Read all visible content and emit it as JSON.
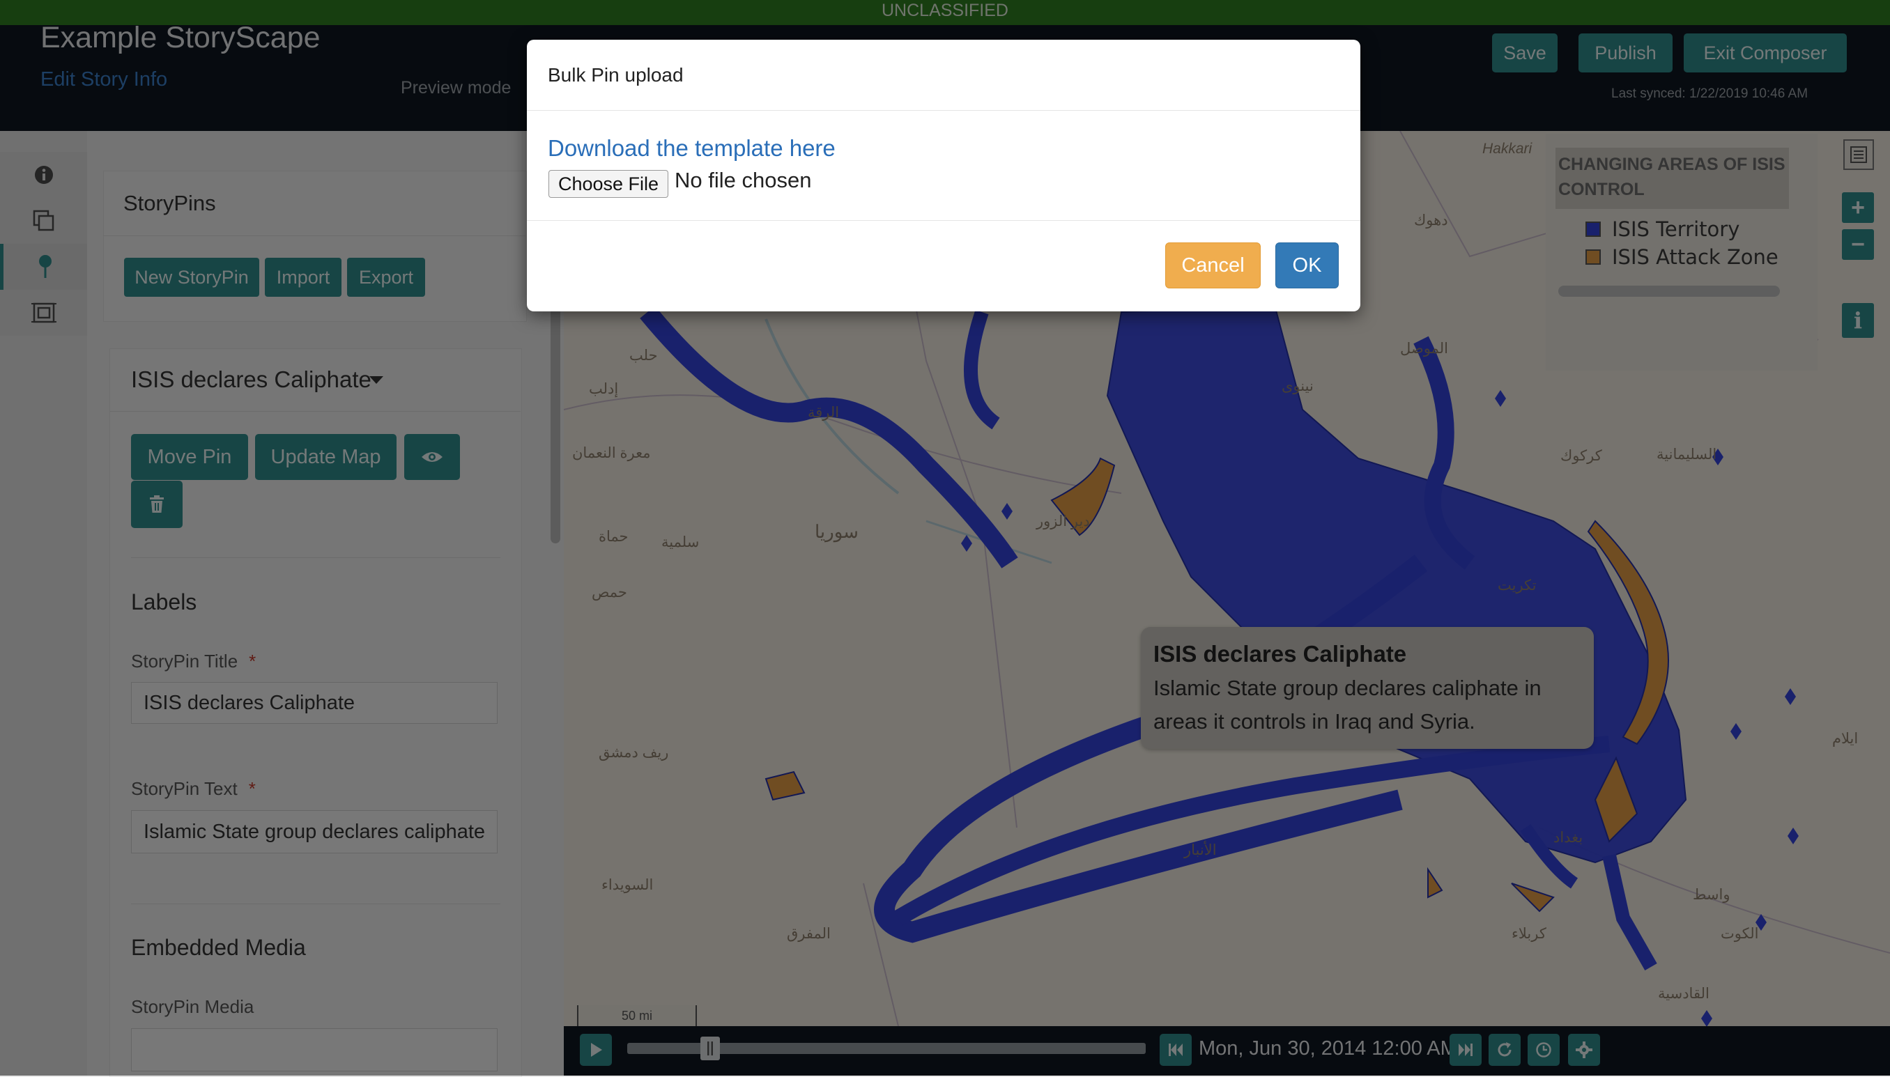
{
  "banner": {
    "text": "UNCLASSIFIED",
    "color": "#2e7d21"
  },
  "header": {
    "title": "Example StoryScape",
    "edit_link": "Edit Story Info",
    "preview_mode": "Preview mode",
    "buttons": {
      "save": "Save",
      "publish": "Publish",
      "exit": "Exit Composer"
    },
    "last_synced": "Last synced: 1/22/2019 10:46 AM"
  },
  "iconbar": {
    "icons": [
      "info-icon",
      "layers-icon",
      "pin-icon",
      "frame-icon"
    ],
    "active": "pin-icon"
  },
  "storypins": {
    "title": "StoryPins",
    "buttons": {
      "new": "New StoryPin",
      "import": "Import",
      "export": "Export"
    }
  },
  "pin": {
    "header": "ISIS declares Caliphate",
    "buttons": {
      "move": "Move Pin",
      "update_map": "Update Map"
    },
    "labels_heading": "Labels",
    "title_label": "StoryPin Title",
    "title_value": "ISIS declares Caliphate",
    "text_label": "StoryPin Text",
    "text_value": "Islamic State group declares caliphate",
    "required_mark": "*",
    "media_heading": "Embedded Media",
    "media_label": "StoryPin Media",
    "media_value": ""
  },
  "legend": {
    "title": "CHANGING AREAS OF ISIS CONTROL",
    "items": [
      {
        "label": "ISIS Territory",
        "color": "#3342d9"
      },
      {
        "label": "ISIS Attack Zone",
        "color": "#e09a45"
      }
    ]
  },
  "map": {
    "labels": [
      "Hakkari",
      "حلب",
      "إدلب",
      "معرة النعمان",
      "حماة",
      "سلمية",
      "حمص",
      "سوريا",
      "الرقة",
      "دير الزور",
      "نينوى",
      "كركوك",
      "السليمانية",
      "تكريت",
      "الأنبار",
      "كربلاء",
      "ريف دمشق",
      "السويداء",
      "المفرق",
      "الكوت",
      "واسط",
      "القادسية",
      "ايلام",
      "دهوك",
      "الموصل",
      "بغداد"
    ],
    "tooltip": {
      "title": "ISIS declares Caliphate",
      "text": "Islamic State group declares caliphate in areas it controls in Iraq and Syria."
    },
    "scale": "50 mi",
    "colors": {
      "territory": "#3342d9",
      "attack": "#e09a45"
    }
  },
  "timeline": {
    "date": "Mon, Jun 30, 2014 12:00 AM",
    "progress": 0.16
  },
  "modal": {
    "title": "Bulk Pin upload",
    "download_link": "Download the template here",
    "choose_file": "Choose File",
    "no_file": "No file chosen",
    "cancel": "Cancel",
    "ok": "OK"
  }
}
